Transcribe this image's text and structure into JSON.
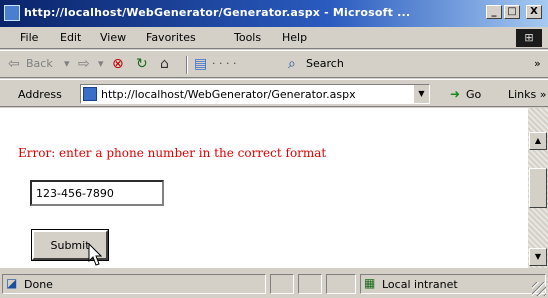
{
  "window": {
    "title": "http://localhost/WebGenerator/Generator.aspx - Microsoft ...",
    "buttons": {
      "minimize": "_",
      "maximize": "□",
      "close": "X"
    }
  },
  "menu": {
    "items": [
      "File",
      "Edit",
      "View",
      "Favorites",
      "Tools",
      "Help"
    ]
  },
  "toolbar": {
    "back_label": "Back",
    "search_label": "Search",
    "more_label": "»"
  },
  "address": {
    "label": "Address",
    "url": "http://localhost/WebGenerator/Generator.aspx",
    "go_label": "Go",
    "links_label": "Links »"
  },
  "page": {
    "error_message": "Error: enter a phone number in the correct format",
    "phone_value": "123-456-7890",
    "submit_label": "Submit"
  },
  "status": {
    "left_text": "Done",
    "zone_text": "Local intranet"
  },
  "colors": {
    "error_text": "#e00000",
    "titlebar_start": "#0a246a",
    "titlebar_end": "#a6caf0"
  }
}
